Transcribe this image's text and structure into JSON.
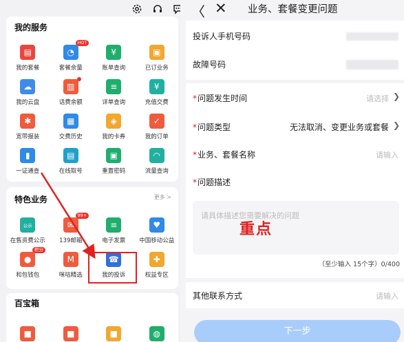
{
  "top_icons": [
    "gear-icon",
    "headset-icon",
    "chat-icon"
  ],
  "services": {
    "title": "我的服务",
    "items": [
      {
        "label": "我的套餐",
        "icon": "package-icon",
        "color": "#e9463f"
      },
      {
        "label": "套餐余量",
        "icon": "pie-chart-icon",
        "color": "#2f8ae8",
        "badge": "HOT"
      },
      {
        "label": "账单查询",
        "icon": "bill-icon",
        "color": "#1fae6b"
      },
      {
        "label": "已订业务",
        "icon": "briefcase-icon",
        "color": "#f2a72e"
      },
      {
        "label": "我的云盘",
        "icon": "cloud-folder-icon",
        "color": "#3f8ce8"
      },
      {
        "label": "话费余额",
        "icon": "wallet-icon",
        "color": "#ef5b3d",
        "dot": true
      },
      {
        "label": "详单查询",
        "icon": "list-icon",
        "color": "#1fae6b"
      },
      {
        "label": "充值交费",
        "icon": "yuan-coin-icon",
        "color": "#21b0a0"
      },
      {
        "label": "宽带报装",
        "icon": "broadband-icon",
        "color": "#ef5b3d"
      },
      {
        "label": "交费历史",
        "icon": "history-icon",
        "color": "#2f8ae8"
      },
      {
        "label": "我的卡券",
        "icon": "coupon-icon",
        "color": "#f2a72e"
      },
      {
        "label": "我的订单",
        "icon": "order-icon",
        "color": "#ef5b3d"
      },
      {
        "label": "一证通查",
        "icon": "id-check-icon",
        "color": "#2f8ae8"
      },
      {
        "label": "在线取号",
        "icon": "store-icon",
        "color": "#21a1c9"
      },
      {
        "label": "重置密码",
        "icon": "lock-reset-icon",
        "color": "#1fae6b"
      },
      {
        "label": "流量查询",
        "icon": "speedometer-icon",
        "color": "#21b0a0"
      }
    ]
  },
  "features": {
    "title": "特色业务",
    "more": "更多 >",
    "items": [
      {
        "label": "在售资费公示",
        "icon": "notice-board-icon",
        "color": "#21b0a0",
        "tag": "公示"
      },
      {
        "label": "139邮箱",
        "icon": "mail-icon",
        "color": "#ef5b3d",
        "badge": "99+"
      },
      {
        "label": "电子发票",
        "icon": "invoice-icon",
        "color": "#1fae6b"
      },
      {
        "label": "中国移动公益",
        "icon": "charity-hands-icon",
        "color": "#2f8ae8"
      },
      {
        "label": "和包钱包",
        "icon": "money-bag-icon",
        "color": "#ef5b3d",
        "badge": "积分"
      },
      {
        "label": "咪咕精选",
        "icon": "migu-icon",
        "color": "#ef5b3d"
      },
      {
        "label": "我的投诉",
        "icon": "phone-complaint-icon",
        "color": "#2f6fe0"
      },
      {
        "label": "权益专区",
        "icon": "gift-box-icon",
        "color": "#f2a72e"
      }
    ]
  },
  "toolbox": {
    "title": "百宝箱",
    "items": [
      {
        "icon": "toolbox-icon-1",
        "color": "#ef5b3d"
      },
      {
        "icon": "toolbox-icon-2",
        "color": "#ef5b3d"
      },
      {
        "icon": "toolbox-icon-3",
        "color": "#f2a72e"
      },
      {
        "icon": "wechat-icon",
        "color": "#1fae6b"
      }
    ]
  },
  "nav": {
    "back": "〈",
    "close": "✕",
    "title": "业务、套餐变更问题"
  },
  "form": {
    "phone_label": "投诉人手机号码",
    "fault_label": "故障号码",
    "time_label": "问题发生时间",
    "time_placeholder": "请选择",
    "type_label": "问题类型",
    "type_value": "无法取消、变更业务或套餐",
    "name_label": "业务、套餐名称",
    "name_placeholder": "请输入",
    "desc_label": "问题描述",
    "desc_placeholder": "请具体描述您需要解决的问题",
    "desc_annotation": "重点",
    "counter": "（至少输入 15个字）0/400",
    "contact_label": "其他联系方式",
    "contact_placeholder": "请输入",
    "next_button": "下一步"
  },
  "colors": {
    "accent_blue": "#a9cdfa",
    "required_red": "#e02020",
    "highlight_red": "#e0211f"
  }
}
